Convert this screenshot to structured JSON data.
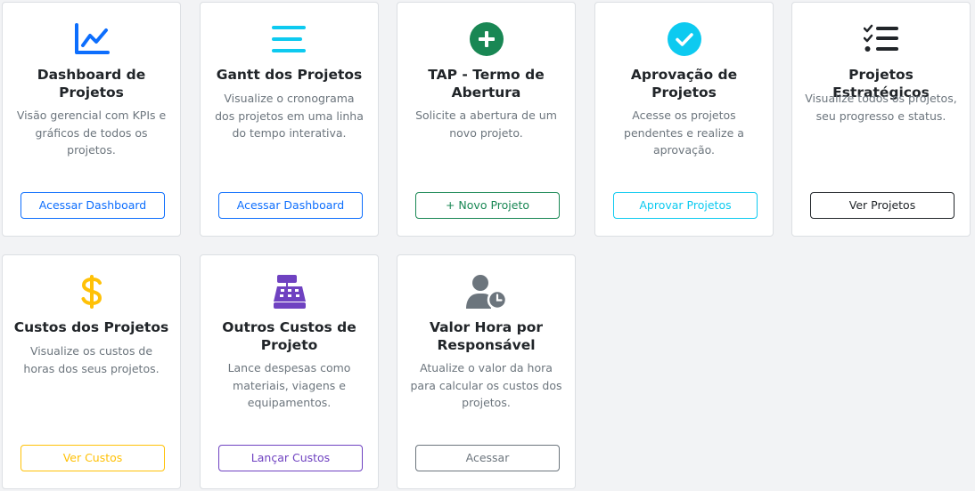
{
  "cards": [
    {
      "icon": "line-chart-icon",
      "title": "Dashboard de Projetos",
      "description": "Visão gerencial com KPIs e gráficos de todos os projetos.",
      "button": "Acessar Dashboard"
    },
    {
      "icon": "bars-icon",
      "title": "Gantt dos Projetos",
      "description": "Visualize o cronograma dos projetos em uma linha do tempo interativa.",
      "button": "Acessar Dashboard"
    },
    {
      "icon": "plus-circle-icon",
      "title": "TAP - Termo de Abertura",
      "description": "Solicite a abertura de um novo projeto.",
      "button": "+ Novo Projeto"
    },
    {
      "icon": "check-circle-icon",
      "title": "Aprovação de Projetos",
      "description": "Acesse os projetos pendentes e realize a aprovação.",
      "button": "Aprovar Projetos"
    },
    {
      "icon": "list-check-icon",
      "title": "Projetos Estratégicos",
      "description": "Visualize todos os projetos, seu progresso e status.",
      "button": "Ver Projetos"
    },
    {
      "icon": "dollar-icon",
      "title": "Custos dos Projetos",
      "description": "Visualize os custos de horas dos seus projetos.",
      "button": "Ver Custos"
    },
    {
      "icon": "cash-register-icon",
      "title": "Outros Custos de Projeto",
      "description": "Lance despesas como materiais, viagens e equipamentos.",
      "button": "Lançar Custos"
    },
    {
      "icon": "user-clock-icon",
      "title": "Valor Hora por Responsável",
      "description": "Atualize o valor da hora para calcular os custos dos projetos.",
      "button": "Acessar"
    }
  ],
  "colors": {
    "blue": "#0d6efd",
    "cyan": "#0dcaf0",
    "green": "#198754",
    "dark": "#212529",
    "yellow": "#ffc107",
    "purple": "#6f42c1",
    "gray": "#6c757d"
  }
}
